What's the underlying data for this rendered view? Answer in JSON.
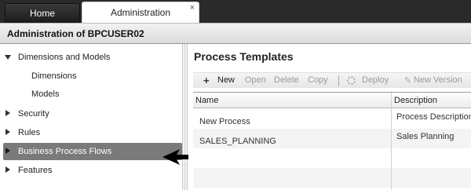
{
  "tabs": [
    {
      "label": "Home",
      "active": false
    },
    {
      "label": "Administration",
      "active": true,
      "close": "×"
    }
  ],
  "window_title": "Administration of BPCUSER02",
  "sidebar": {
    "items": [
      {
        "label": "Dimensions and Models",
        "expanded": true,
        "level": 0
      },
      {
        "label": "Dimensions",
        "level": 1
      },
      {
        "label": "Models",
        "level": 1
      },
      {
        "label": "Security",
        "expanded": false,
        "level": 0
      },
      {
        "label": "Rules",
        "expanded": false,
        "level": 0
      },
      {
        "label": "Business Process Flows",
        "expanded": false,
        "level": 0,
        "selected": true
      },
      {
        "label": "Features",
        "expanded": false,
        "level": 0
      }
    ]
  },
  "main": {
    "title": "Process Templates",
    "toolbar": {
      "new": "New",
      "open": "Open",
      "delete": "Delete",
      "copy": "Copy",
      "deploy": "Deploy",
      "new_version": "New Version"
    },
    "table": {
      "columns": [
        "Name",
        "Description"
      ],
      "rows": [
        {
          "name": "New Process",
          "description": "Process Description"
        },
        {
          "name": "SALES_PLANNING",
          "description": "Sales Planning"
        }
      ]
    }
  },
  "colors": {
    "tabbar": "#2a2a2a",
    "selected_item": "#7a7a7a",
    "disabled_text": "#9a9a9a"
  }
}
